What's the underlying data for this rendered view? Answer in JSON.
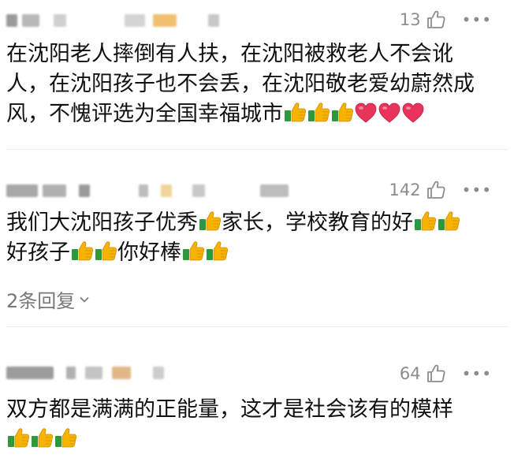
{
  "comments": [
    {
      "likes": "13",
      "text_lines": [
        "在沈阳老人摔倒有人扶，在沈阳被救老人不会讹",
        "人，在沈阳孩子也不会丢，在沈阳敬老爱幼蔚然成",
        "风，不愧评选为全国幸福城市"
      ],
      "trailing_emojis": [
        "thumbs-up",
        "thumbs-up",
        "thumbs-up",
        "heart",
        "heart",
        "heart"
      ]
    },
    {
      "likes": "142",
      "segments_line1": [
        "我们大沈阳孩子优秀",
        "家长，学校教育的好"
      ],
      "segments_line2": [
        "好孩子",
        "你好棒"
      ],
      "replies_label": "2条回复"
    },
    {
      "likes": "64",
      "text_lines": [
        "双方都是满满的正能量，这才是社会该有的模样"
      ],
      "trailing_emojis": [
        "thumbs-up",
        "thumbs-up",
        "thumbs-up"
      ]
    }
  ],
  "icons": {
    "like": "thumbs-up-outline-icon",
    "more": "more-dots-icon",
    "expand": "chevron-down-icon"
  },
  "colors": {
    "heart": "#e8345a",
    "thumb": "#f6b400",
    "text_muted": "#8c8c8c"
  }
}
